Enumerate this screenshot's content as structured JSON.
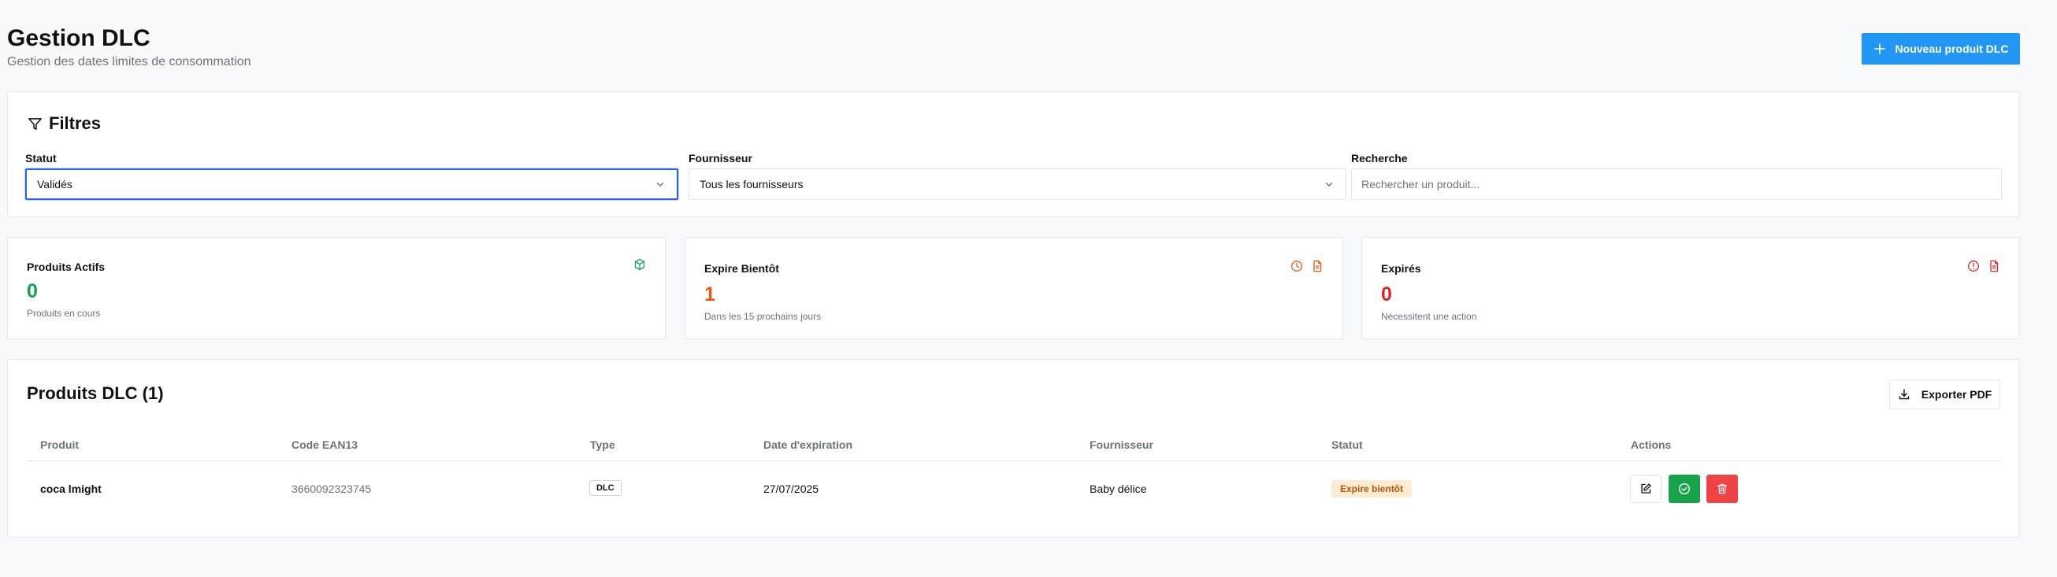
{
  "header": {
    "title": "Gestion DLC",
    "subtitle": "Gestion des dates limites de consommation",
    "new_button": "Nouveau produit DLC"
  },
  "filters": {
    "title": "Filtres",
    "status": {
      "label": "Statut",
      "value": "Validés"
    },
    "supplier": {
      "label": "Fournisseur",
      "value": "Tous les fournisseurs"
    },
    "search": {
      "label": "Recherche",
      "placeholder": "Rechercher un produit..."
    }
  },
  "stats": [
    {
      "title": "Produits Actifs",
      "value": "0",
      "description": "Produits en cours",
      "color": "#16a34a",
      "icons": [
        "package-icon"
      ]
    },
    {
      "title": "Expire Bientôt",
      "value": "1",
      "description": "Dans les 15 prochains jours",
      "color": "#ea580c",
      "icons": [
        "clock-icon",
        "file-icon"
      ]
    },
    {
      "title": "Expirés",
      "value": "0",
      "description": "Nécessitent une action",
      "color": "#dc2626",
      "icons": [
        "alert-circle-icon",
        "file-icon"
      ]
    }
  ],
  "table": {
    "title": "Produits DLC (1)",
    "export_button": "Exporter PDF",
    "columns": [
      "Produit",
      "Code EAN13",
      "Type",
      "Date d'expiration",
      "Fournisseur",
      "Statut",
      "Actions"
    ],
    "rows": [
      {
        "product": "coca lmight",
        "ean": "3660092323745",
        "type": "DLC",
        "expiration": "27/07/2025",
        "supplier": "Baby délice",
        "status": "Expire bientôt"
      }
    ]
  },
  "colors": {
    "primary": "#2196f3",
    "success": "#16a34a",
    "warning": "#ea580c",
    "danger": "#ef4444",
    "status_badge_bg": "#fdecd2"
  }
}
